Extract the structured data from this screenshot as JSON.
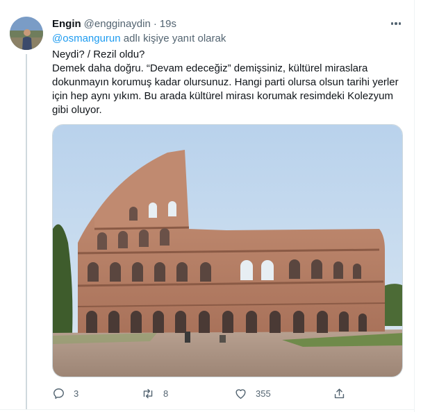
{
  "tweet": {
    "author_name": "Engin",
    "author_handle": "@engginaydin",
    "separator": "·",
    "timestamp": "19s",
    "reply_mention": "@osmangurun",
    "reply_suffix": " adlı kişiye yanıt olarak",
    "text_lines": [
      "Neydi? / Rezil oldu?",
      "Demek daha doğru. “Devam edeceğiz” demişsiniz, kültürel miraslara",
      "dokunmayın korumuş kadar olursunuz. Hangi parti olursa olsun tarihi yerler",
      "için hep aynı yıkım. Bu arada kültürel mirası korumak resimdeki Kolezyum",
      "gibi oluyor."
    ]
  },
  "actions": {
    "reply_count": "3",
    "retweet_count": "8",
    "like_count": "355"
  },
  "icons": {
    "more": "more-horizontal-icon",
    "reply": "reply-icon",
    "retweet": "retweet-icon",
    "like": "heart-icon",
    "share": "share-icon"
  },
  "colors": {
    "text": "#0f1419",
    "secondary": "#536471",
    "accent": "#1d9bf0",
    "border": "#cfd9de"
  }
}
